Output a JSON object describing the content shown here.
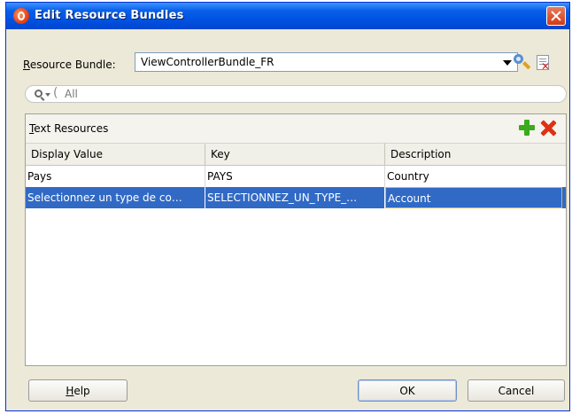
{
  "window": {
    "title": "Edit Resource Bundles"
  },
  "resource_bundle": {
    "label_prefix": "",
    "label_mnemonic": "R",
    "label_rest": "esource Bundle:",
    "selected": "ViewControllerBundle_FR",
    "search_icon": "search-icon",
    "delete_icon": "delete-file-icon"
  },
  "filter": {
    "placeholder": "All"
  },
  "text_resources": {
    "title_mnemonic": "T",
    "title_rest": "ext Resources",
    "add_icon": "add-icon",
    "remove_icon": "remove-icon",
    "columns": [
      "Display Value",
      "Key",
      "Description"
    ],
    "rows": [
      {
        "display": "Pays",
        "key": "PAYS",
        "description": "Country",
        "selected": false
      },
      {
        "display": "Selectionnez un type de co…",
        "key": "SELECTIONNEZ_UN_TYPE_…",
        "description": "Account",
        "selected": true
      }
    ]
  },
  "buttons": {
    "help_mnemonic": "H",
    "help_rest": "elp",
    "ok": "OK",
    "cancel": "Cancel"
  },
  "colors": {
    "selection": "#316AC5",
    "titlebar": "#0054E3",
    "dialog_bg": "#ECE9D8"
  }
}
